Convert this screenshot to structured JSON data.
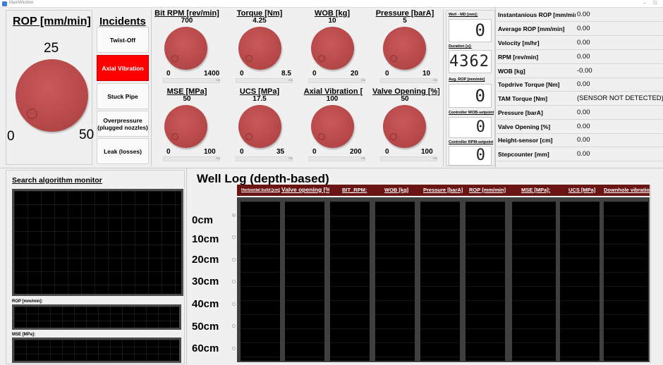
{
  "window": {
    "title": "MainWindow",
    "minimize_glyph": "–",
    "close_glyph": "⊡"
  },
  "rop_dial": {
    "title": "ROP [mm/min]",
    "mid_label": "25",
    "min_label": "0",
    "max_label": "50"
  },
  "incidents": {
    "title": "Incidents",
    "buttons": [
      {
        "label": "Twist-Off",
        "active": false
      },
      {
        "label": "Axial Vibration",
        "active": true
      },
      {
        "label": "Stuck Pipe",
        "active": false
      },
      {
        "label": "Overpressure (plugged nozzles)",
        "active": false
      },
      {
        "label": "Leak (losses)",
        "active": false
      }
    ]
  },
  "gauges": [
    {
      "title": "Bit RPM [rev/min]",
      "max": "700",
      "lo": "0",
      "hi": "1400"
    },
    {
      "title": "Torque [Nm]",
      "max": "4.25",
      "lo": "0",
      "hi": "8.5"
    },
    {
      "title": "WOB [kg]",
      "max": "10",
      "lo": "0",
      "hi": "20"
    },
    {
      "title": "Pressure [barA]",
      "max": "5",
      "lo": "0",
      "hi": "10"
    },
    {
      "title": "MSE [MPa]",
      "max": "50",
      "lo": "0",
      "hi": "100"
    },
    {
      "title": "UCS [MPa]",
      "max": "17.5",
      "lo": "0",
      "hi": "35"
    },
    {
      "title": "Axial Vibration [",
      "max": "100",
      "lo": "0",
      "hi": "200"
    },
    {
      "title": "Valve Opening [%]",
      "max": "50",
      "lo": "0",
      "hi": "100"
    }
  ],
  "gauge_bar_percent_label": "0%",
  "lcd": [
    {
      "label": "Well - MD [mm]:",
      "value": "0"
    },
    {
      "label": "Duration [s]:",
      "value": "4362"
    },
    {
      "label": "Avg. ROP [mm/min]",
      "value": "0"
    },
    {
      "label": "Controller WOB-setpoint",
      "value": "0"
    },
    {
      "label": "Controller RPM-setpoint",
      "value": "0"
    }
  ],
  "values_table": [
    {
      "key": "Instantanious ROP [mm/min]",
      "value": "0.00"
    },
    {
      "key": "Average ROP [mm/min]",
      "value": "0.00"
    },
    {
      "key": "Velocity [m/hr]",
      "value": "0.00"
    },
    {
      "key": "RPM [rev/min]",
      "value": "0.00"
    },
    {
      "key": "WOB [kg]",
      "value": "-0.00"
    },
    {
      "key": "Topdrive Torque [Nm]",
      "value": "0.00"
    },
    {
      "key": "TAM Torque [Nm]",
      "value": "(SENSOR NOT DETECTED)"
    },
    {
      "key": "Pressure [barA]",
      "value": "0.00"
    },
    {
      "key": "Valve Opening [%]",
      "value": "0.00"
    },
    {
      "key": "Height-sensor [cm]",
      "value": "0.00"
    },
    {
      "key": "Stepcounter [mm]",
      "value": "0.00"
    }
  ],
  "search_monitor": {
    "title": "Search algorithm monitor",
    "rop_label": "ROP [mm/min]:",
    "mse_label": "MSE [MPa]:"
  },
  "well_log": {
    "title": "Well Log (depth-based)",
    "depths": [
      "0cm",
      "10cm",
      "20cm",
      "30cm",
      "40cm",
      "50cm",
      "60cm"
    ],
    "selected_depth_index": 0,
    "columns": [
      "Horizontal build [cm]",
      "Valve opening [%]:",
      "BIT_RPM:",
      "WOB [kg]",
      "Pressure [barA]",
      "ROP [mm/min]",
      "MSE [MPa]:",
      "UCS [MPa]",
      "Downhole vibration"
    ]
  },
  "colors": {
    "knob": "#b94a4b",
    "alarm": "#ff0000",
    "log_header": "#6b1414",
    "plot_bg": "#000000"
  }
}
